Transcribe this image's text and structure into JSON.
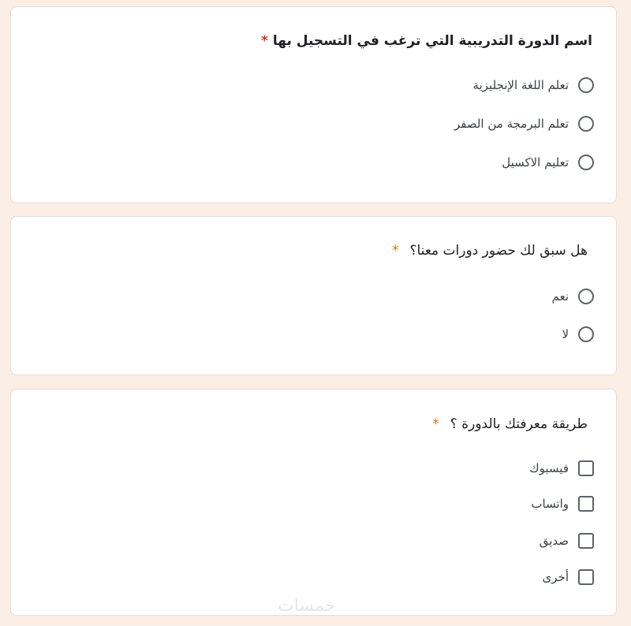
{
  "questions": [
    {
      "title": "اسم الدورة التدريبية التي ترغب في التسجيل بها",
      "required_mark": "*",
      "type": "radio",
      "options": [
        "تعلم اللغة الإنجليزية",
        "تعلم البرمجة من الصفر",
        "تعليم الاكسيل"
      ]
    },
    {
      "title": "هل سبق لك حضور دورات معنا؟",
      "required_mark": "*",
      "type": "radio",
      "options": [
        "نعم",
        "لا"
      ]
    },
    {
      "title": "طريقة معرفتك بالدورة ؟",
      "required_mark": "*",
      "type": "checkbox",
      "options": [
        "فيسبوك",
        "واتساب",
        "صديق",
        "أخرى"
      ]
    }
  ],
  "watermark": "خمسات",
  "colors": {
    "page_background": "#fbeee4",
    "required_star_red": "#d93025",
    "required_star_orange": "#e37400"
  }
}
